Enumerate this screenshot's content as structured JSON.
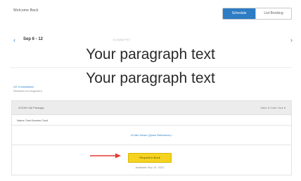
{
  "header": {
    "app_name": "Welcome Back",
    "toggle": {
      "active_label": "Schedule",
      "inactive_label": "List Booking"
    }
  },
  "date_nav": {
    "date_label": "Sep 6 - 12",
    "time_label": "10:00AM PST",
    "prev_icon": "chevron-left-icon",
    "next_icon": "chevron-right-icon"
  },
  "overlay": {
    "line_1": "Your paragraph text",
    "line_2": "Your paragraph text"
  },
  "info": {
    "title": "UX Consultation",
    "subtitle": "Sessions for beginners"
  },
  "card": {
    "header_left": "ZOOM Call Package",
    "header_right": "Save & Cost: Your ▾",
    "row_text": "Name Card Access Card",
    "link_text": "10 Min Demo (Quick Reference) ›"
  },
  "action": {
    "button_label": "Request to Book",
    "sub_text": "Available Sep 10, 2022"
  },
  "colors": {
    "accent": "#2d7cc4",
    "button_yellow": "#f5d320",
    "arrow_red": "#e53935"
  }
}
